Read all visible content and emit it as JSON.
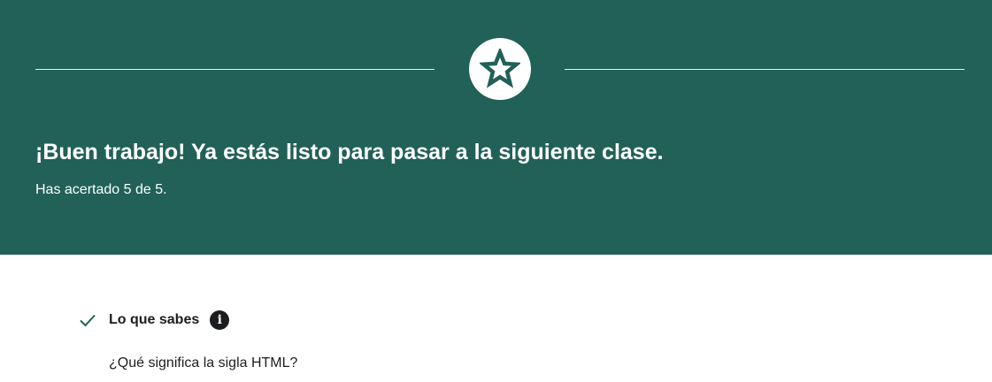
{
  "banner": {
    "headline": "¡Buen trabajo! Ya estás listo para pasar a la siguiente clase.",
    "score_text": "Has acertado 5 de 5.",
    "icon": "star-icon",
    "background_color": "#216157"
  },
  "results": {
    "section_title": "Lo que sabes",
    "section_icon": "check-icon",
    "info_icon_glyph": "i",
    "questions": [
      "¿Qué significa la sigla HTML?"
    ]
  }
}
